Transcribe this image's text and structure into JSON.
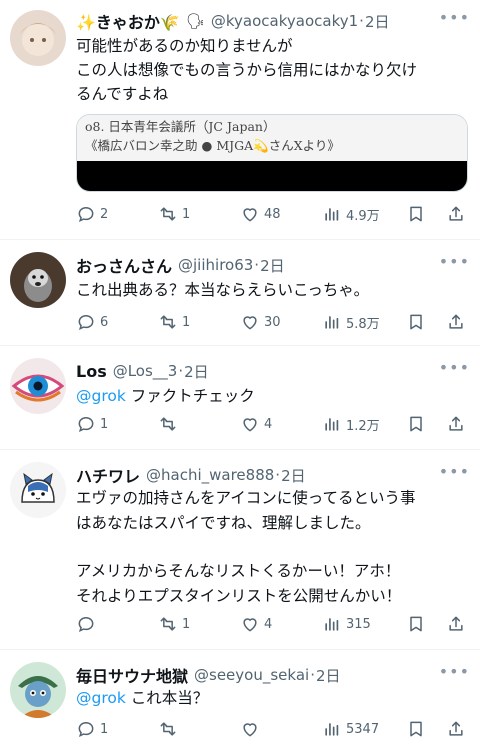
{
  "tweets": [
    {
      "name": "✨きゃおか🌾",
      "badge": "🗣",
      "handle": "@kyaocakyaocaky1",
      "time": "2日",
      "lines": [
        "可能性があるのか知りませんが",
        "この人は想像でもの言うから信用にはかなり欠け",
        "るんですよね"
      ],
      "media_lines": [
        "o8. 日本青年会議所（JC Japan）",
        "《橋広バロン幸之助 ● MJGA💫さんXより》"
      ],
      "replies": "2",
      "reposts": "1",
      "likes": "48",
      "views": "4.9万"
    },
    {
      "name": "おっさんさん",
      "handle": "@jiihiro63",
      "time": "2日",
      "lines": [
        "これ出典ある？本当ならえらいこっちゃ。"
      ],
      "replies": "6",
      "reposts": "1",
      "likes": "30",
      "views": "5.8万"
    },
    {
      "name": "Los",
      "handle": "@Los__3",
      "time": "2日",
      "mention": "@grok",
      "lines": [
        "ファクトチェック"
      ],
      "replies": "1",
      "reposts": "",
      "likes": "4",
      "views": "1.2万"
    },
    {
      "name": "ハチワレ",
      "handle": "@hachi_ware888",
      "time": "2日",
      "lines": [
        "エヴァの加持さんをアイコンに使ってるという事",
        "はあなたはスパイですね、理解しました。",
        "",
        "アメリカからそんなリストくるかーい！アホ！",
        "それよりエプスタインリストを公開せんかい！"
      ],
      "replies": "",
      "reposts": "1",
      "likes": "4",
      "views": "315"
    },
    {
      "name": "毎日サウナ地獄",
      "handle": "@seeyou_sekai",
      "time": "2日",
      "mention": "@grok",
      "lines": [
        "これ本当？"
      ],
      "replies": "1",
      "reposts": "",
      "likes": "",
      "views": "5347"
    }
  ],
  "colors": {
    "mention": "#1d9bf0",
    "secondary_text": "#536471",
    "divider": "#eff3f4"
  },
  "icons": [
    "reply-icon",
    "repost-icon",
    "like-icon",
    "views-icon",
    "bookmark-icon",
    "share-icon",
    "more-icon"
  ]
}
